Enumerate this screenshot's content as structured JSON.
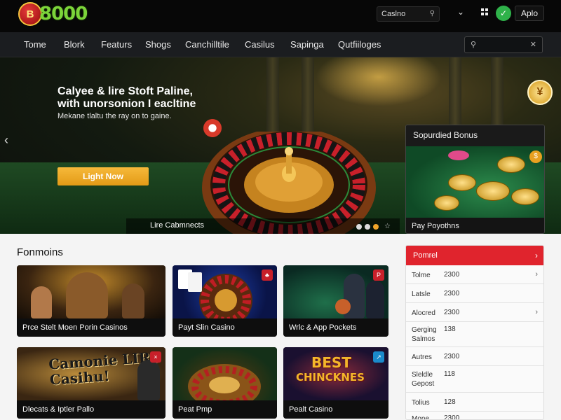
{
  "brand": {
    "logo_text": "8000",
    "badge_text": "B"
  },
  "topbar": {
    "search_text": "Caslno",
    "apply_label": "Aplo",
    "check_glyph": "✓",
    "chevron_glyph": "⌄",
    "search_glyph": "⚲"
  },
  "nav": {
    "items": [
      "Tome",
      "Blork",
      "Featurs",
      "Shogs",
      "Canchilltile",
      "Casilus",
      "Sapinga",
      "Qutfiiloges"
    ]
  },
  "hero": {
    "title_line1": "Calyee & lire Stoft Paline,",
    "title_line2": "with unorsonion I eacltine",
    "subtitle": "Mekane tlaltu the ray on to gaine.",
    "cta_label": "Light Now",
    "caption": "Lire Cabmnects",
    "prev_glyph": "‹",
    "star_glyph": "☆",
    "coin_glyph": "¥"
  },
  "bonus_card": {
    "title": "Sopurdied Bonus",
    "footer": "Pay Poyothns",
    "badge": "$"
  },
  "promotions": {
    "title": "Fonmoins",
    "cards": [
      {
        "caption": "Prce Stelt Moen Porin Casinos",
        "corner": ""
      },
      {
        "caption": "Payt Slin Casino",
        "corner": "♣"
      },
      {
        "caption": "Wrlc & App Pockets",
        "corner": "P"
      },
      {
        "caption": "Dlecats & Iptler Pallo",
        "corner": "×"
      },
      {
        "caption": "Peat Pmp",
        "corner": ""
      },
      {
        "caption": "Pealt Casino",
        "corner": "↗"
      }
    ],
    "card_art_text": {
      "card4": "Camonie LIRS Casihu!",
      "card6_line1": "BEST",
      "card6_line2": "CHINCKNES"
    }
  },
  "sidebar": {
    "header": "Pomrel",
    "header_chev": "›",
    "rows": [
      {
        "key": "Tolme",
        "value": "2300",
        "chev": "›"
      },
      {
        "key": "Latsle",
        "value": "2300",
        "chev": ""
      },
      {
        "key": "Alocred",
        "value": "2300",
        "chev": "›"
      },
      {
        "key": "Gerging Salmos",
        "value": "138",
        "chev": ""
      },
      {
        "key": "Autres",
        "value": "2300",
        "chev": ""
      },
      {
        "key": "Sleldle Gepost",
        "value": "118",
        "chev": ""
      },
      {
        "key": "Tolius",
        "value": "128",
        "chev": ""
      },
      {
        "key": "Mone",
        "value": "2300",
        "chev": ""
      }
    ]
  }
}
